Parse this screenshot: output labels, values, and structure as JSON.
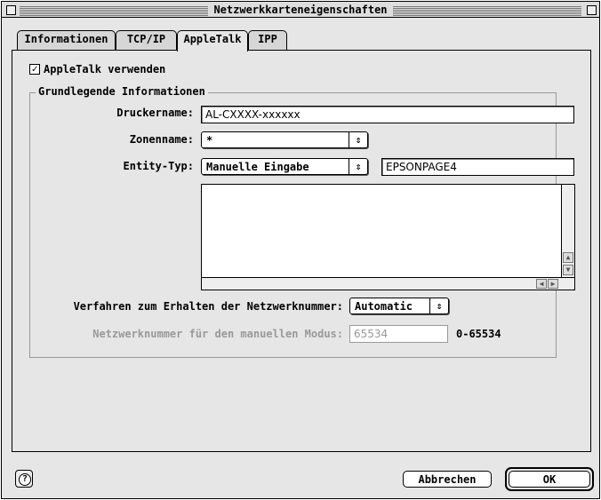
{
  "window": {
    "title": "Netzwerkkarteneigenschaften"
  },
  "tabs": [
    {
      "label": "Informationen",
      "active": false
    },
    {
      "label": "TCP/IP",
      "active": false
    },
    {
      "label": "AppleTalk",
      "active": true
    },
    {
      "label": "IPP",
      "active": false
    }
  ],
  "appletalk": {
    "use_label": "AppleTalk verwenden",
    "use_checked": true,
    "check_mark": "✓"
  },
  "basic_info": {
    "legend": "Grundlegende Informationen",
    "printer_name_label": "Druckername:",
    "printer_name_value": "AL-CXXXX-xxxxxx",
    "zone_name_label": "Zonenname:",
    "zone_name_value": "*",
    "entity_type_label": "Entity-Typ:",
    "entity_type_value": "Manuelle Eingabe",
    "entity_type_text": "EPSONPAGE4",
    "method_label": "Verfahren zum Erhalten der Netzwerknummer:",
    "method_value": "Automatic",
    "manual_label": "Netzwerknummer für den manuellen Modus:",
    "manual_value": "65534",
    "manual_range": "0-65534"
  },
  "icons": {
    "popup_arrow": "⇕",
    "help": "?",
    "scroll_up": "▲",
    "scroll_down": "▼",
    "scroll_left": "◀",
    "scroll_right": "▶"
  },
  "buttons": {
    "cancel": "Abbrechen",
    "ok": "OK"
  }
}
